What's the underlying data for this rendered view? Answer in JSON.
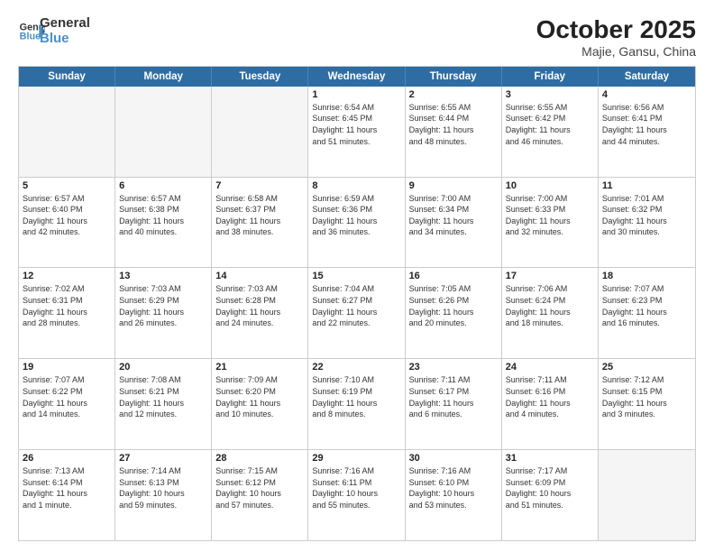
{
  "logo": {
    "line1": "General",
    "line2": "Blue"
  },
  "title": "October 2025",
  "subtitle": "Majie, Gansu, China",
  "days_of_week": [
    "Sunday",
    "Monday",
    "Tuesday",
    "Wednesday",
    "Thursday",
    "Friday",
    "Saturday"
  ],
  "weeks": [
    [
      {
        "day": "",
        "info": "",
        "empty": true
      },
      {
        "day": "",
        "info": "",
        "empty": true
      },
      {
        "day": "",
        "info": "",
        "empty": true
      },
      {
        "day": "1",
        "info": "Sunrise: 6:54 AM\nSunset: 6:45 PM\nDaylight: 11 hours\nand 51 minutes.",
        "empty": false
      },
      {
        "day": "2",
        "info": "Sunrise: 6:55 AM\nSunset: 6:44 PM\nDaylight: 11 hours\nand 48 minutes.",
        "empty": false
      },
      {
        "day": "3",
        "info": "Sunrise: 6:55 AM\nSunset: 6:42 PM\nDaylight: 11 hours\nand 46 minutes.",
        "empty": false
      },
      {
        "day": "4",
        "info": "Sunrise: 6:56 AM\nSunset: 6:41 PM\nDaylight: 11 hours\nand 44 minutes.",
        "empty": false
      }
    ],
    [
      {
        "day": "5",
        "info": "Sunrise: 6:57 AM\nSunset: 6:40 PM\nDaylight: 11 hours\nand 42 minutes.",
        "empty": false
      },
      {
        "day": "6",
        "info": "Sunrise: 6:57 AM\nSunset: 6:38 PM\nDaylight: 11 hours\nand 40 minutes.",
        "empty": false
      },
      {
        "day": "7",
        "info": "Sunrise: 6:58 AM\nSunset: 6:37 PM\nDaylight: 11 hours\nand 38 minutes.",
        "empty": false
      },
      {
        "day": "8",
        "info": "Sunrise: 6:59 AM\nSunset: 6:36 PM\nDaylight: 11 hours\nand 36 minutes.",
        "empty": false
      },
      {
        "day": "9",
        "info": "Sunrise: 7:00 AM\nSunset: 6:34 PM\nDaylight: 11 hours\nand 34 minutes.",
        "empty": false
      },
      {
        "day": "10",
        "info": "Sunrise: 7:00 AM\nSunset: 6:33 PM\nDaylight: 11 hours\nand 32 minutes.",
        "empty": false
      },
      {
        "day": "11",
        "info": "Sunrise: 7:01 AM\nSunset: 6:32 PM\nDaylight: 11 hours\nand 30 minutes.",
        "empty": false
      }
    ],
    [
      {
        "day": "12",
        "info": "Sunrise: 7:02 AM\nSunset: 6:31 PM\nDaylight: 11 hours\nand 28 minutes.",
        "empty": false
      },
      {
        "day": "13",
        "info": "Sunrise: 7:03 AM\nSunset: 6:29 PM\nDaylight: 11 hours\nand 26 minutes.",
        "empty": false
      },
      {
        "day": "14",
        "info": "Sunrise: 7:03 AM\nSunset: 6:28 PM\nDaylight: 11 hours\nand 24 minutes.",
        "empty": false
      },
      {
        "day": "15",
        "info": "Sunrise: 7:04 AM\nSunset: 6:27 PM\nDaylight: 11 hours\nand 22 minutes.",
        "empty": false
      },
      {
        "day": "16",
        "info": "Sunrise: 7:05 AM\nSunset: 6:26 PM\nDaylight: 11 hours\nand 20 minutes.",
        "empty": false
      },
      {
        "day": "17",
        "info": "Sunrise: 7:06 AM\nSunset: 6:24 PM\nDaylight: 11 hours\nand 18 minutes.",
        "empty": false
      },
      {
        "day": "18",
        "info": "Sunrise: 7:07 AM\nSunset: 6:23 PM\nDaylight: 11 hours\nand 16 minutes.",
        "empty": false
      }
    ],
    [
      {
        "day": "19",
        "info": "Sunrise: 7:07 AM\nSunset: 6:22 PM\nDaylight: 11 hours\nand 14 minutes.",
        "empty": false
      },
      {
        "day": "20",
        "info": "Sunrise: 7:08 AM\nSunset: 6:21 PM\nDaylight: 11 hours\nand 12 minutes.",
        "empty": false
      },
      {
        "day": "21",
        "info": "Sunrise: 7:09 AM\nSunset: 6:20 PM\nDaylight: 11 hours\nand 10 minutes.",
        "empty": false
      },
      {
        "day": "22",
        "info": "Sunrise: 7:10 AM\nSunset: 6:19 PM\nDaylight: 11 hours\nand 8 minutes.",
        "empty": false
      },
      {
        "day": "23",
        "info": "Sunrise: 7:11 AM\nSunset: 6:17 PM\nDaylight: 11 hours\nand 6 minutes.",
        "empty": false
      },
      {
        "day": "24",
        "info": "Sunrise: 7:11 AM\nSunset: 6:16 PM\nDaylight: 11 hours\nand 4 minutes.",
        "empty": false
      },
      {
        "day": "25",
        "info": "Sunrise: 7:12 AM\nSunset: 6:15 PM\nDaylight: 11 hours\nand 3 minutes.",
        "empty": false
      }
    ],
    [
      {
        "day": "26",
        "info": "Sunrise: 7:13 AM\nSunset: 6:14 PM\nDaylight: 11 hours\nand 1 minute.",
        "empty": false
      },
      {
        "day": "27",
        "info": "Sunrise: 7:14 AM\nSunset: 6:13 PM\nDaylight: 10 hours\nand 59 minutes.",
        "empty": false
      },
      {
        "day": "28",
        "info": "Sunrise: 7:15 AM\nSunset: 6:12 PM\nDaylight: 10 hours\nand 57 minutes.",
        "empty": false
      },
      {
        "day": "29",
        "info": "Sunrise: 7:16 AM\nSunset: 6:11 PM\nDaylight: 10 hours\nand 55 minutes.",
        "empty": false
      },
      {
        "day": "30",
        "info": "Sunrise: 7:16 AM\nSunset: 6:10 PM\nDaylight: 10 hours\nand 53 minutes.",
        "empty": false
      },
      {
        "day": "31",
        "info": "Sunrise: 7:17 AM\nSunset: 6:09 PM\nDaylight: 10 hours\nand 51 minutes.",
        "empty": false
      },
      {
        "day": "",
        "info": "",
        "empty": true
      }
    ]
  ]
}
